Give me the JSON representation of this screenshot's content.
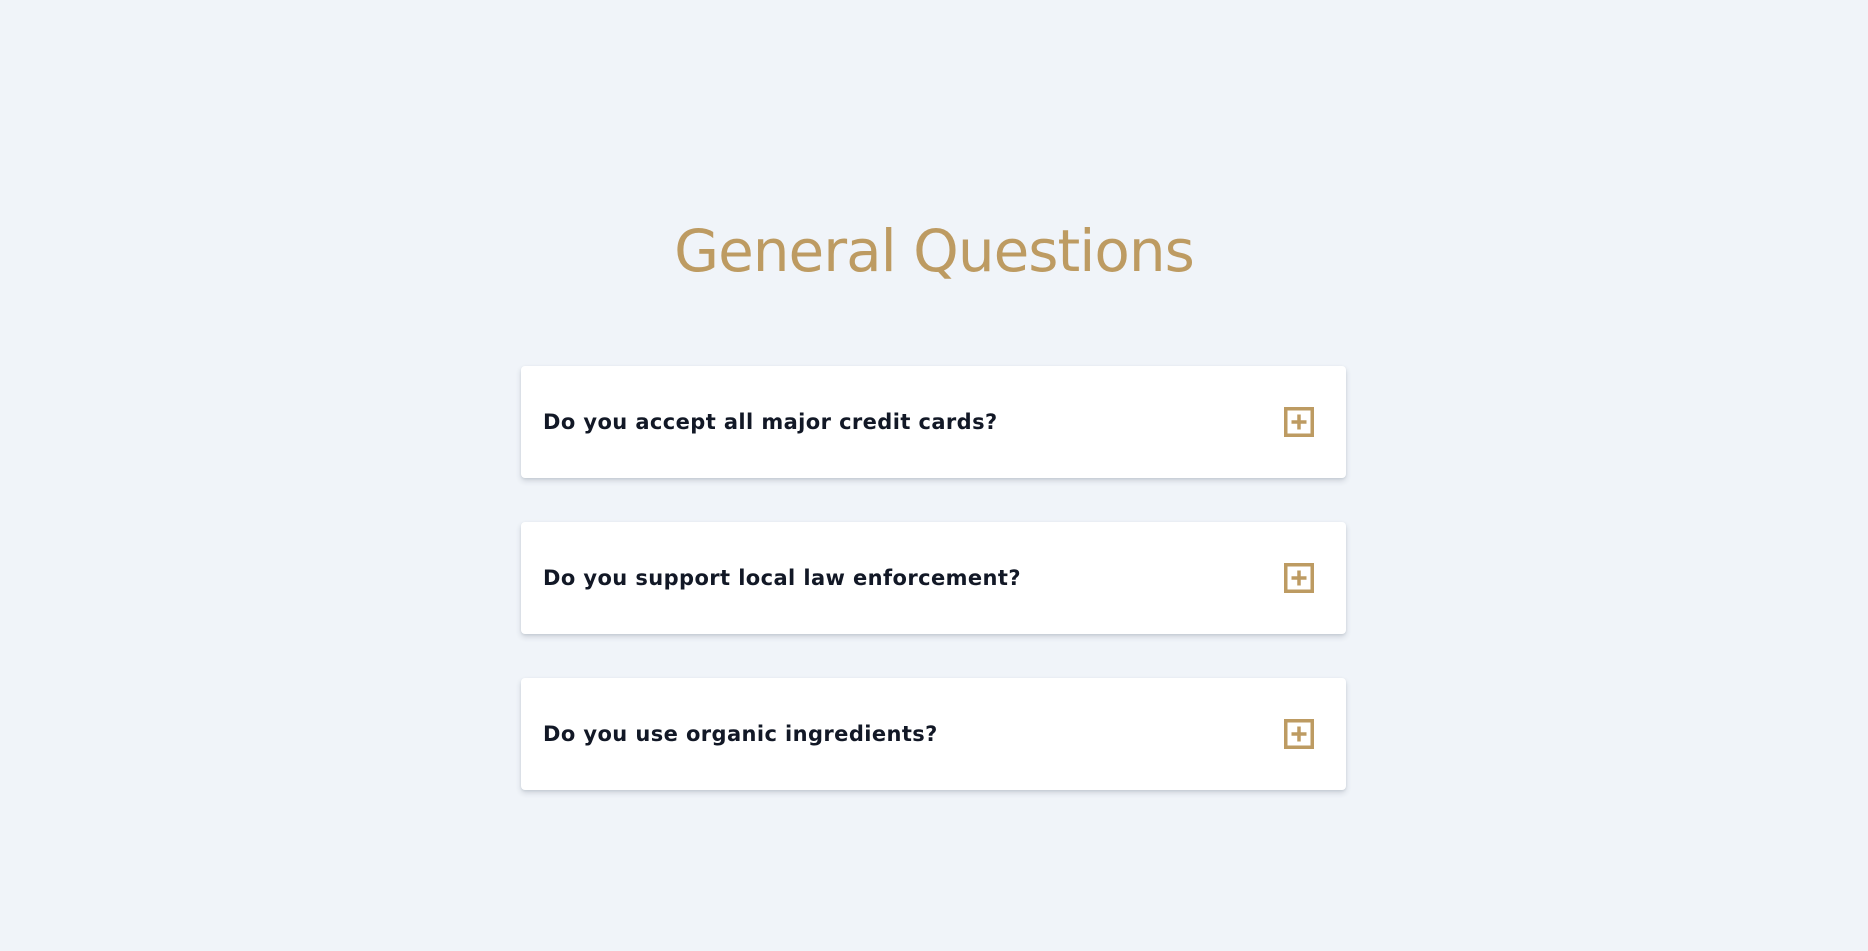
{
  "title": "General Questions",
  "colors": {
    "background": "#f0f4f9",
    "accent": "#bd9b62",
    "card": "#ffffff",
    "question_text": "#121826"
  },
  "faq": [
    {
      "question": "Do you accept all major credit cards?",
      "icon": "plus-square-icon"
    },
    {
      "question": "Do you support local law enforcement?",
      "icon": "plus-square-icon"
    },
    {
      "question": "Do you use organic ingredients?",
      "icon": "plus-square-icon"
    }
  ]
}
